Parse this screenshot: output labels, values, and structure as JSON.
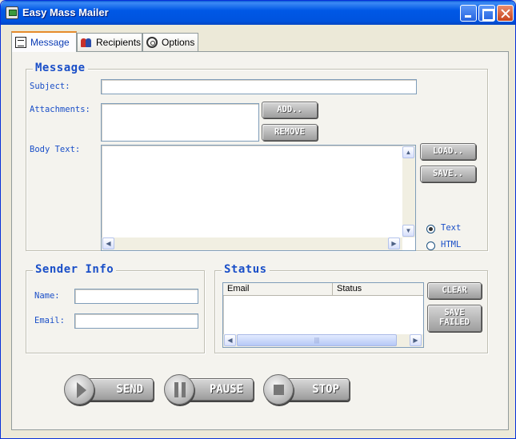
{
  "window": {
    "title": "Easy Mass Mailer"
  },
  "tabs": [
    {
      "label": "Message",
      "icon": "message-icon"
    },
    {
      "label": "Recipients",
      "icon": "recipients-icon"
    },
    {
      "label": "Options",
      "icon": "options-icon"
    }
  ],
  "message": {
    "group_title": "Message",
    "subject_label": "Subject:",
    "subject_value": "",
    "attachments_label": "Attachments:",
    "add_button": "ADD..",
    "remove_button": "REMOVE",
    "body_label": "Body Text:",
    "body_value": "",
    "load_button": "LOAD..",
    "save_button": "SAVE..",
    "format_options": [
      "Text",
      "HTML"
    ],
    "format_selected": "Text"
  },
  "sender": {
    "group_title": "Sender Info",
    "name_label": "Name:",
    "name_value": "",
    "email_label": "Email:",
    "email_value": ""
  },
  "status": {
    "group_title": "Status",
    "columns": [
      "Email",
      "Status"
    ],
    "rows": [],
    "clear_button": "CLEAR",
    "save_failed_line1": "SAVE",
    "save_failed_line2": "FAILED"
  },
  "actions": {
    "send": "SEND",
    "pause": "PAUSE",
    "stop": "STOP"
  },
  "colors": {
    "titlebar": "#0058e6",
    "label_blue": "#1a4fc8",
    "window_bg": "#ece9d8"
  }
}
